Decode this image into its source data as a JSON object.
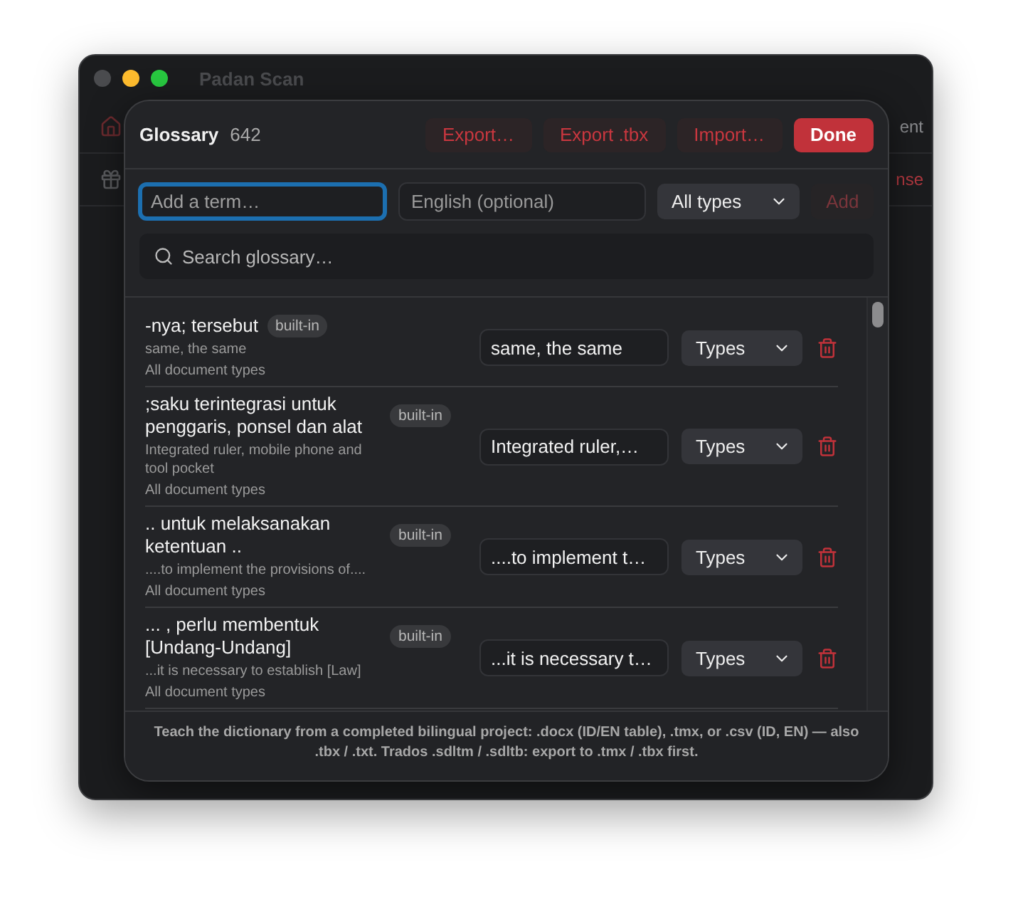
{
  "window": {
    "title": "Padan Scan",
    "nav_tail": "ent",
    "license_tail": "nse"
  },
  "glossary": {
    "title": "Glossary",
    "count": "642",
    "actions": [
      {
        "label": "Export…",
        "kind": "secondary"
      },
      {
        "label": "Export .tbx",
        "kind": "secondary"
      },
      {
        "label": "Import…",
        "kind": "secondary"
      },
      {
        "label": "Done",
        "kind": "primary"
      }
    ],
    "term_field": {
      "placeholder": "Add a term…",
      "focused": true
    },
    "english_field": {
      "placeholder": "English (optional)",
      "focused": false
    },
    "type_select": {
      "value": "All types"
    },
    "add_button": {
      "label": "Add",
      "disabled": true
    },
    "search": {
      "placeholder": "Search glossary…"
    },
    "entries": [
      {
        "term": "-nya; tersebut",
        "badge": "built-in",
        "gloss": "same, the same",
        "scope": "All document types",
        "translation": "same, the same",
        "types": "Types"
      },
      {
        "term": ";saku terintegrasi untuk penggaris, ponsel dan alat",
        "badge": "built-in",
        "gloss": "Integrated ruler, mobile phone and tool pocket",
        "scope": "All document types",
        "translation": "Integrated ruler,…",
        "types": "Types"
      },
      {
        "term": ".. untuk melaksanakan ketentuan ..",
        "badge": "built-in",
        "gloss": "....to implement the provisions of....",
        "scope": "All document types",
        "translation": "....to implement t…",
        "types": "Types"
      },
      {
        "term": "... , perlu membentuk [Undang-Undang]",
        "badge": "built-in",
        "gloss": "...it is necessary to establish [Law]",
        "scope": "All document types",
        "translation": "...it is necessary t…",
        "types": "Types"
      }
    ],
    "note": "Teach the dictionary from a completed bilingual project: .docx (ID/EN table), .tmx, or .csv (ID, EN) — also .tbx / .txt. Trados .sdltm / .sdltb: export to .tmx / .tbx first."
  }
}
